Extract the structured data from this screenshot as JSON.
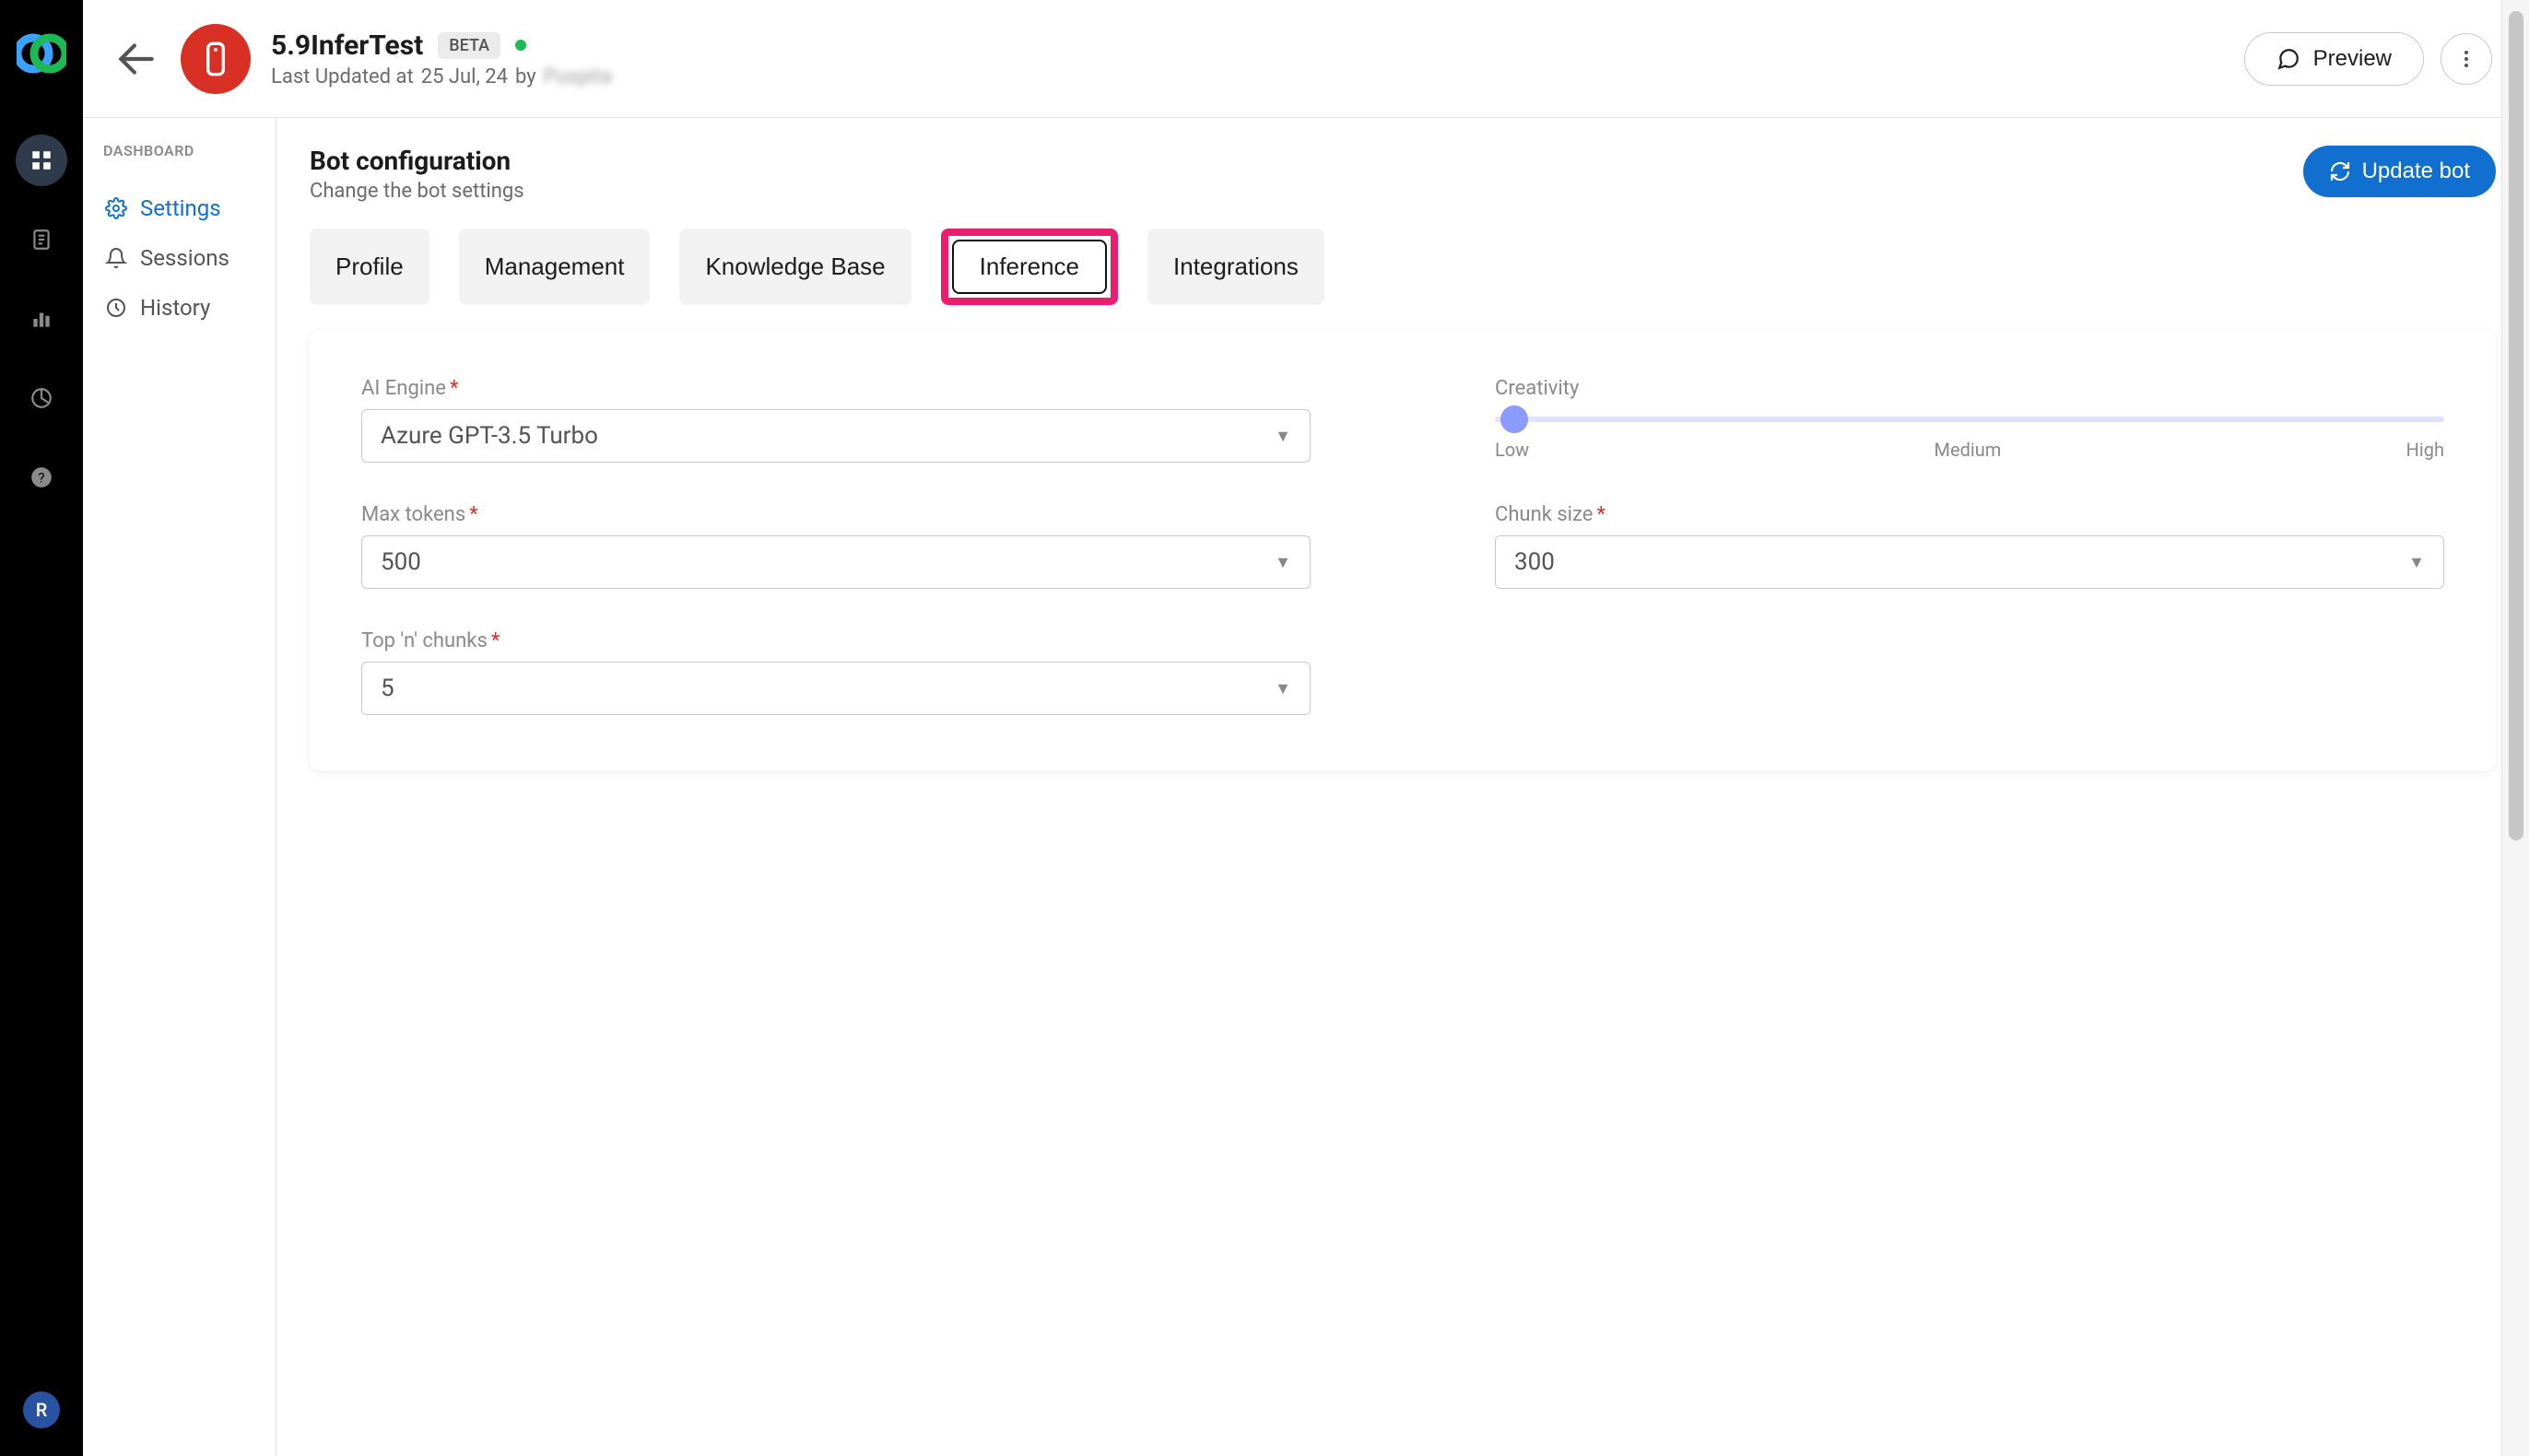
{
  "rail": {
    "avatar_initial": "R"
  },
  "header": {
    "bot_title": "5.9InferTest",
    "beta_label": "BETA",
    "last_updated_prefix": "Last Updated at ",
    "last_updated_date": "25 Jul, 24",
    "by_word": " by ",
    "author": "Puspita",
    "preview_label": "Preview"
  },
  "sidebar": {
    "heading": "DASHBOARD",
    "items": [
      {
        "label": "Settings"
      },
      {
        "label": "Sessions"
      },
      {
        "label": "History"
      }
    ]
  },
  "page": {
    "title": "Bot configuration",
    "subtitle": "Change the bot settings",
    "update_label": "Update bot"
  },
  "tabs": [
    {
      "label": "Profile"
    },
    {
      "label": "Management"
    },
    {
      "label": "Knowledge Base"
    },
    {
      "label": "Inference"
    },
    {
      "label": "Integrations"
    }
  ],
  "form": {
    "ai_engine_label": "AI Engine",
    "ai_engine_value": "Azure GPT-3.5 Turbo",
    "creativity_label": "Creativity",
    "creativity_low": "Low",
    "creativity_medium": "Medium",
    "creativity_high": "High",
    "max_tokens_label": "Max tokens",
    "max_tokens_value": "500",
    "chunk_size_label": "Chunk size",
    "chunk_size_value": "300",
    "top_n_label": "Top 'n' chunks",
    "top_n_value": "5"
  }
}
